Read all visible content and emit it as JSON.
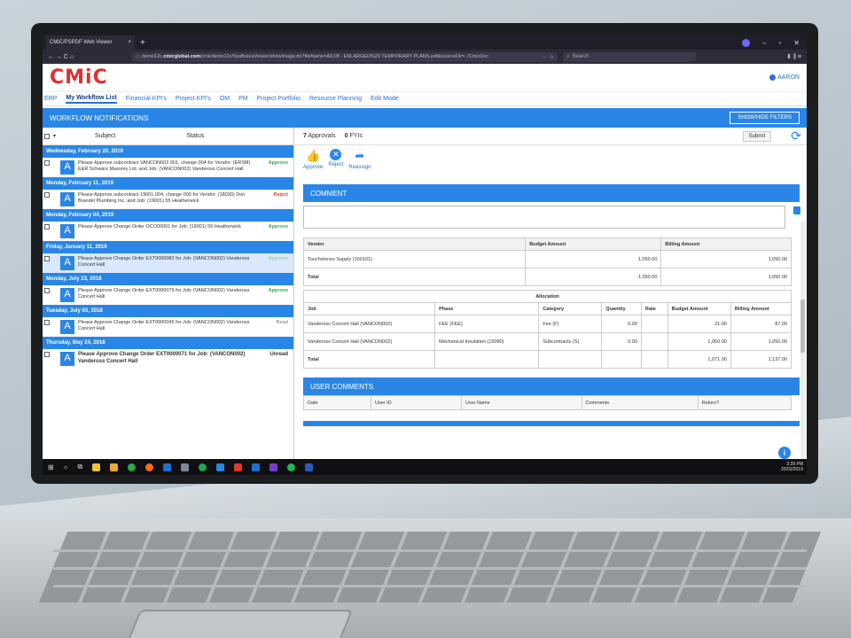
{
  "browser": {
    "tab_title": "CMiC/PSPDF Web Viewer",
    "tab_close": "×",
    "new_tab": "+",
    "url_prefix": "demo12c.",
    "url_domain": "cmicglobal.com",
    "url_rest": "/cmicdemo12c/SysBravaViewer/showImage.do?fileName=A0.08 - ENLARGED%20 TEMPORARY PLANS.pdf&sourceDir=../CmicDoc",
    "url_actions": "···  ☆",
    "search_placeholder": "Search",
    "nav_icons": "← → C ⌂",
    "right_icons": "⬇  ⫼  ≡",
    "window_controls": [
      "–",
      "▫",
      "✕"
    ]
  },
  "app": {
    "logo": "CMiC",
    "user": "AARON",
    "nav": [
      "ERP",
      "My Workflow List",
      "Financial KPI's",
      "Project KPI's",
      "OM",
      "PM",
      "Project Portfolio",
      "Resource Planning",
      "Edit Mode"
    ],
    "workflow_title": "WORKFLOW NOTIFICATIONS",
    "filters_button": "SHOW/HIDE FILTERS"
  },
  "list": {
    "col_subject": "Subject",
    "col_status": "Status",
    "groups": [
      {
        "date": "Wednesday, February 20, 2019",
        "items": [
          {
            "text": "Please Approve subcontract VANCON002.001, change 004 for Vendor: (ERSM) E&R Schwarz Masonry Ltd. and Job: (VANCON002) Vandeross Concert Hall",
            "status": "Approve"
          }
        ]
      },
      {
        "date": "Monday, February 11, 2019",
        "items": [
          {
            "text": "Please Approve subcontract 19001.004, change 000 for Vendor: (18030) Don Brandel Plumbing Inc. and Job: (19001) 55 Heatherwick",
            "status": "Reject"
          }
        ]
      },
      {
        "date": "Monday, February 04, 2019",
        "items": [
          {
            "text": "Please Approve Change Order OCO00001 for Job: (19001) 55 Heatherwick",
            "status": "Approve"
          }
        ]
      },
      {
        "date": "Friday, January 11, 2019",
        "items": [
          {
            "text": "Please Approve Change Order EXT0000082 for Job: (VANCON002) Vandeross Concert Hall",
            "status": "Approve"
          }
        ]
      },
      {
        "date": "Monday, July 23, 2018",
        "items": [
          {
            "text": "Please Approve Change Order EXT0000079 for Job: (VANCON002) Vandeross Concert Hall",
            "status": "Approve"
          }
        ]
      },
      {
        "date": "Tuesday, July 03, 2018",
        "items": [
          {
            "text": "Please Approve Change Order EXT0000045 for Job: (VANCON002) Vandeross Concert Hall",
            "status": "Read"
          }
        ]
      },
      {
        "date": "Thursday, May 24, 2018",
        "items": [
          {
            "text": "Please Approve Change Order EXT0000071 for Job: (VANCON002) Vandeross Concert Hall",
            "status": "Unread"
          }
        ]
      }
    ],
    "status_colors": {
      "Approve": "#3aa84a",
      "Reject": "#e03a2f",
      "Read": "#999999",
      "Unread": "#333333"
    }
  },
  "detail": {
    "approvals_count": "7",
    "approvals_label": "Approvals",
    "fyis_count": "0",
    "fyis_label": "FYIs",
    "submit": "Submit",
    "actions": [
      "Approve",
      "Reject",
      "Reassign"
    ],
    "comment_title": "COMMENT",
    "vendor_headers": [
      "Vendor",
      "Budget Amount",
      "Billing Amount"
    ],
    "vendor_rows": [
      [
        "Touchstones Supply (100101)",
        "1,050.00",
        "1,050.00"
      ],
      [
        "Total",
        "1,050.00",
        "1,050.00"
      ]
    ],
    "allocation_title": "Allocation",
    "alloc_headers": [
      "Job",
      "Phase",
      "Category",
      "Quantity",
      "Rate",
      "Budget Amount",
      "Billing Amount"
    ],
    "alloc_rows": [
      [
        "Vandeross Concert Hall (VANCON002)",
        "FEE (FEE)",
        "Fee (F)",
        "0.00",
        "",
        "21.00",
        "87.00"
      ],
      [
        "Vandeross Concert Hall (VANCON002)",
        "Mechanical Insulation (15080)",
        "Subcontracts (S)",
        "0.00",
        "",
        "1,050.00",
        "1,050.00"
      ],
      [
        "Total",
        "",
        "",
        "",
        "",
        "1,071.00",
        "1,137.00"
      ]
    ],
    "user_comments_title": "USER COMMENTS",
    "uc_headers": [
      "Date",
      "User ID",
      "User Name",
      "Comments",
      "Return?"
    ]
  },
  "taskbar": {
    "time": "3:39 PM",
    "date": "20/02/2019"
  }
}
